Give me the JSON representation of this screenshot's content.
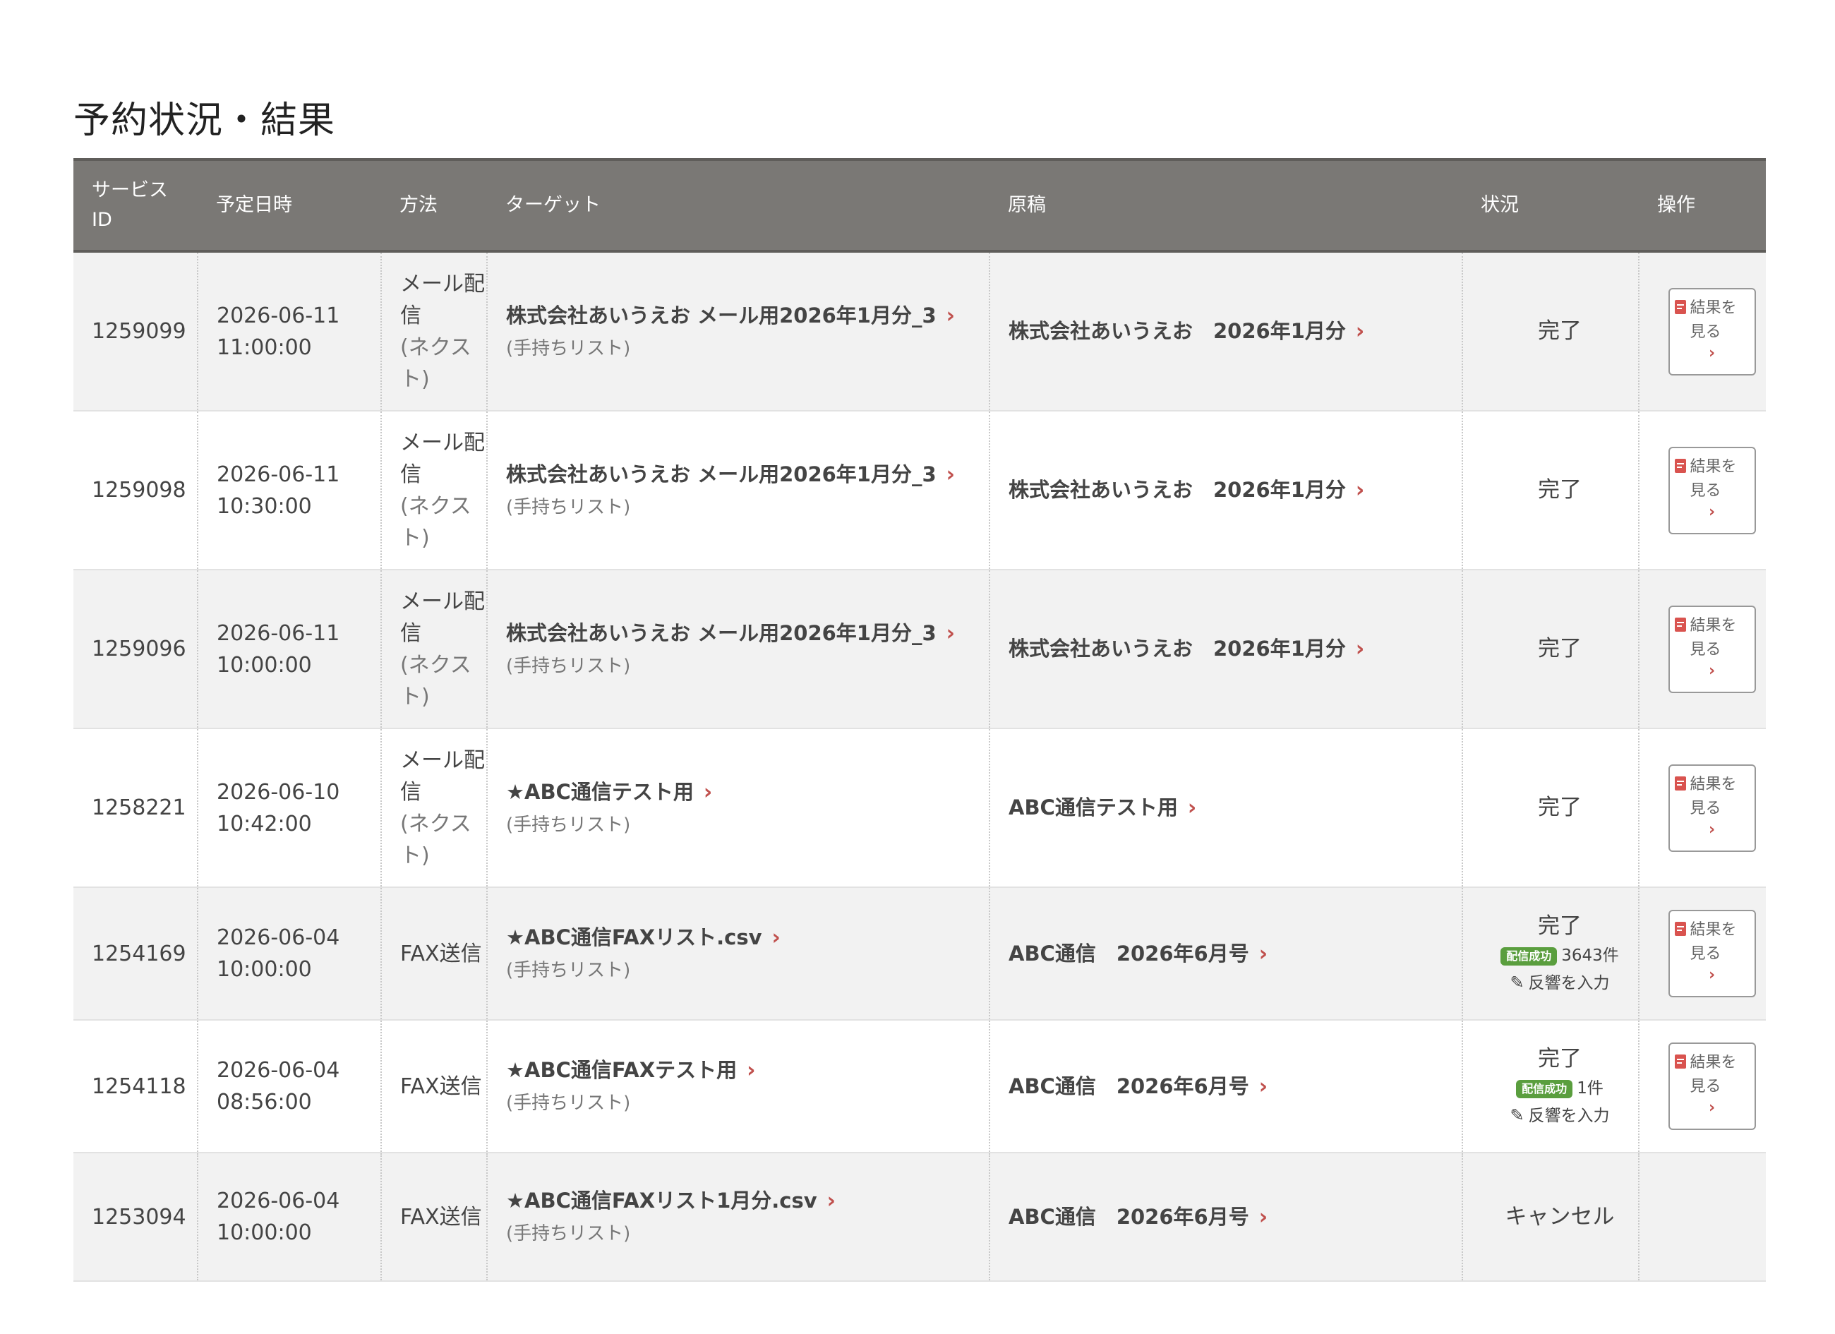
{
  "page": {
    "title": "予約状況・結果"
  },
  "table": {
    "headers": {
      "service_id": "サービス\nID",
      "scheduled": "予定日時",
      "method": "方法",
      "target": "ターゲット",
      "draft": "原稿",
      "status": "状況",
      "operation": "操作"
    },
    "rows": [
      {
        "service_id": "1259099",
        "date": "2026-06-11",
        "time": "11:00:00",
        "method_main": "メール配信",
        "method_sub": "(ネクスト)",
        "target_name": "株式会社あいうえお メール用2026年1月分_3",
        "target_sub": "(手持ちリスト)",
        "draft": "株式会社あいうえお　2026年1月分",
        "status": "完了",
        "button_label": "結果を見る"
      },
      {
        "service_id": "1259098",
        "date": "2026-06-11",
        "time": "10:30:00",
        "method_main": "メール配信",
        "method_sub": "(ネクスト)",
        "target_name": "株式会社あいうえお メール用2026年1月分_3",
        "target_sub": "(手持ちリスト)",
        "draft": "株式会社あいうえお　2026年1月分",
        "status": "完了",
        "button_label": "結果を見る"
      },
      {
        "service_id": "1259096",
        "date": "2026-06-11",
        "time": "10:00:00",
        "method_main": "メール配信",
        "method_sub": "(ネクスト)",
        "target_name": "株式会社あいうえお メール用2026年1月分_3",
        "target_sub": "(手持ちリスト)",
        "draft": "株式会社あいうえお　2026年1月分",
        "status": "完了",
        "button_label": "結果を見る"
      },
      {
        "service_id": "1258221",
        "date": "2026-06-10",
        "time": "10:42:00",
        "method_main": "メール配信",
        "method_sub": "(ネクスト)",
        "target_name": "★ABC通信テスト用",
        "target_sub": "(手持ちリスト)",
        "draft": "ABC通信テスト用",
        "status": "完了",
        "button_label": "結果を見る"
      },
      {
        "service_id": "1254169",
        "date": "2026-06-04",
        "time": "10:00:00",
        "method_main": "FAX送信",
        "method_sub": "",
        "target_name": "★ABC通信FAXリスト.csv",
        "target_sub": "(手持ちリスト)",
        "draft": "ABC通信　2026年6月号",
        "status": "完了",
        "badge": "配信成功",
        "count": "3643件",
        "response_link": "反響を入力",
        "button_label": "結果を見る"
      },
      {
        "service_id": "1254118",
        "date": "2026-06-04",
        "time": "08:56:00",
        "method_main": "FAX送信",
        "method_sub": "",
        "target_name": "★ABC通信FAXテスト用",
        "target_sub": "(手持ちリスト)",
        "draft": "ABC通信　2026年6月号",
        "status": "完了",
        "badge": "配信成功",
        "count": "1件",
        "response_link": "反響を入力",
        "button_label": "結果を見る"
      },
      {
        "service_id": "1253094",
        "date": "2026-06-04",
        "time": "10:00:00",
        "method_main": "FAX送信",
        "method_sub": "",
        "target_name": "★ABC通信FAXリスト1月分.csv",
        "target_sub": "(手持ちリスト)",
        "draft": "ABC通信　2026年6月号",
        "status": "キャンセル"
      }
    ]
  },
  "colors": {
    "header_bg": "#7a7875",
    "chevron": "#c0504d",
    "badge_bg": "#5a9e3e",
    "stripe": "#f2f2f2"
  },
  "icons": {
    "chevron": "chevron-right-icon",
    "result_doc": "document-icon",
    "pencil": "pencil-icon"
  }
}
